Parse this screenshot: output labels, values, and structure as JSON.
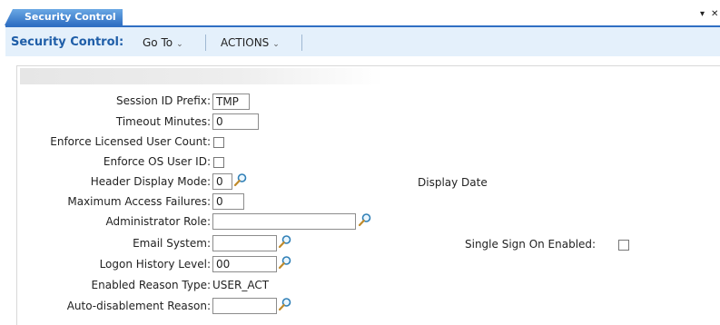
{
  "tab": {
    "label": "Security Control"
  },
  "window_controls": {
    "dropdown": "▾",
    "close": "✕"
  },
  "toolbar": {
    "title": "Security Control:",
    "goto_label": "Go To",
    "actions_label": "ACTIONS"
  },
  "form": {
    "session_id_prefix": {
      "label": "Session ID Prefix:",
      "value": "TMP"
    },
    "timeout_minutes": {
      "label": "Timeout Minutes:",
      "value": "0"
    },
    "enforce_licensed_user_count": {
      "label": "Enforce Licensed User Count:",
      "checked": false
    },
    "enforce_os_user_id": {
      "label": "Enforce OS User ID:",
      "checked": false
    },
    "header_display_mode": {
      "label": "Header Display Mode:",
      "value": "0"
    },
    "display_date": {
      "label": "Display Date"
    },
    "maximum_access_failures": {
      "label": "Maximum Access Failures:",
      "value": "0"
    },
    "administrator_role": {
      "label": "Administrator Role:",
      "value": ""
    },
    "email_system": {
      "label": "Email System:",
      "value": ""
    },
    "single_sign_on_enabled": {
      "label": "Single Sign On Enabled:",
      "checked": false
    },
    "logon_history_level": {
      "label": "Logon History Level:",
      "value": "00"
    },
    "enabled_reason_type": {
      "label": "Enabled Reason Type:",
      "value": "USER_ACT"
    },
    "auto_disablement_reason": {
      "label": "Auto-disablement Reason:",
      "value": ""
    }
  },
  "icons": {
    "lookup": "magnifier-icon"
  },
  "colors": {
    "accent": "#2f6fc3",
    "toolbar_bg": "#e4f0fb",
    "title": "#1f5ea8"
  }
}
